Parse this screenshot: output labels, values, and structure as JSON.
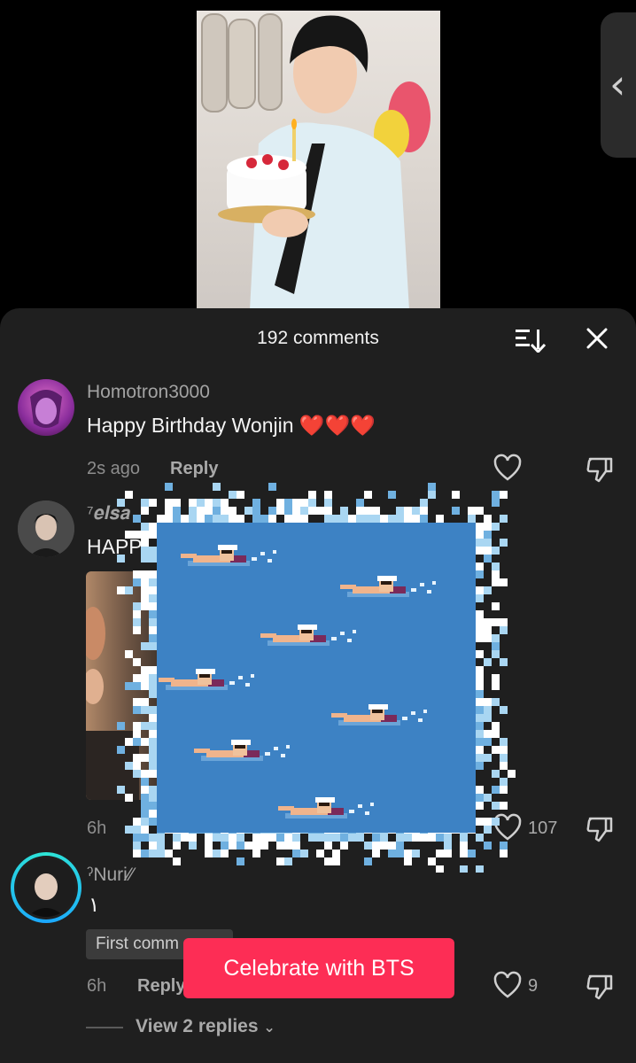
{
  "sheet": {
    "title": "192 comments",
    "sort_icon": "sort-icon",
    "close_icon": "close-icon"
  },
  "comments": [
    {
      "username": "Homotron3000",
      "text": "Happy Birthday Wonjin ❤️❤️❤️",
      "time": "2s ago",
      "reply_label": "Reply"
    },
    {
      "username": "⁷𝒆𝒍𝒔𝒂",
      "text": "HAPP",
      "time": "6h",
      "likes": "107"
    },
    {
      "username": "ˀNuri⁄⁄",
      "text": "١",
      "badge": "First comm",
      "time": "6h",
      "reply_label": "Reply",
      "likes": "9",
      "view_replies": "View 2 replies"
    }
  ],
  "cta": {
    "label": "Celebrate with BTS",
    "color": "#fd2d55"
  },
  "colors": {
    "sheet_bg": "#1f1f1f",
    "pool_blue": "#3d82c4"
  }
}
